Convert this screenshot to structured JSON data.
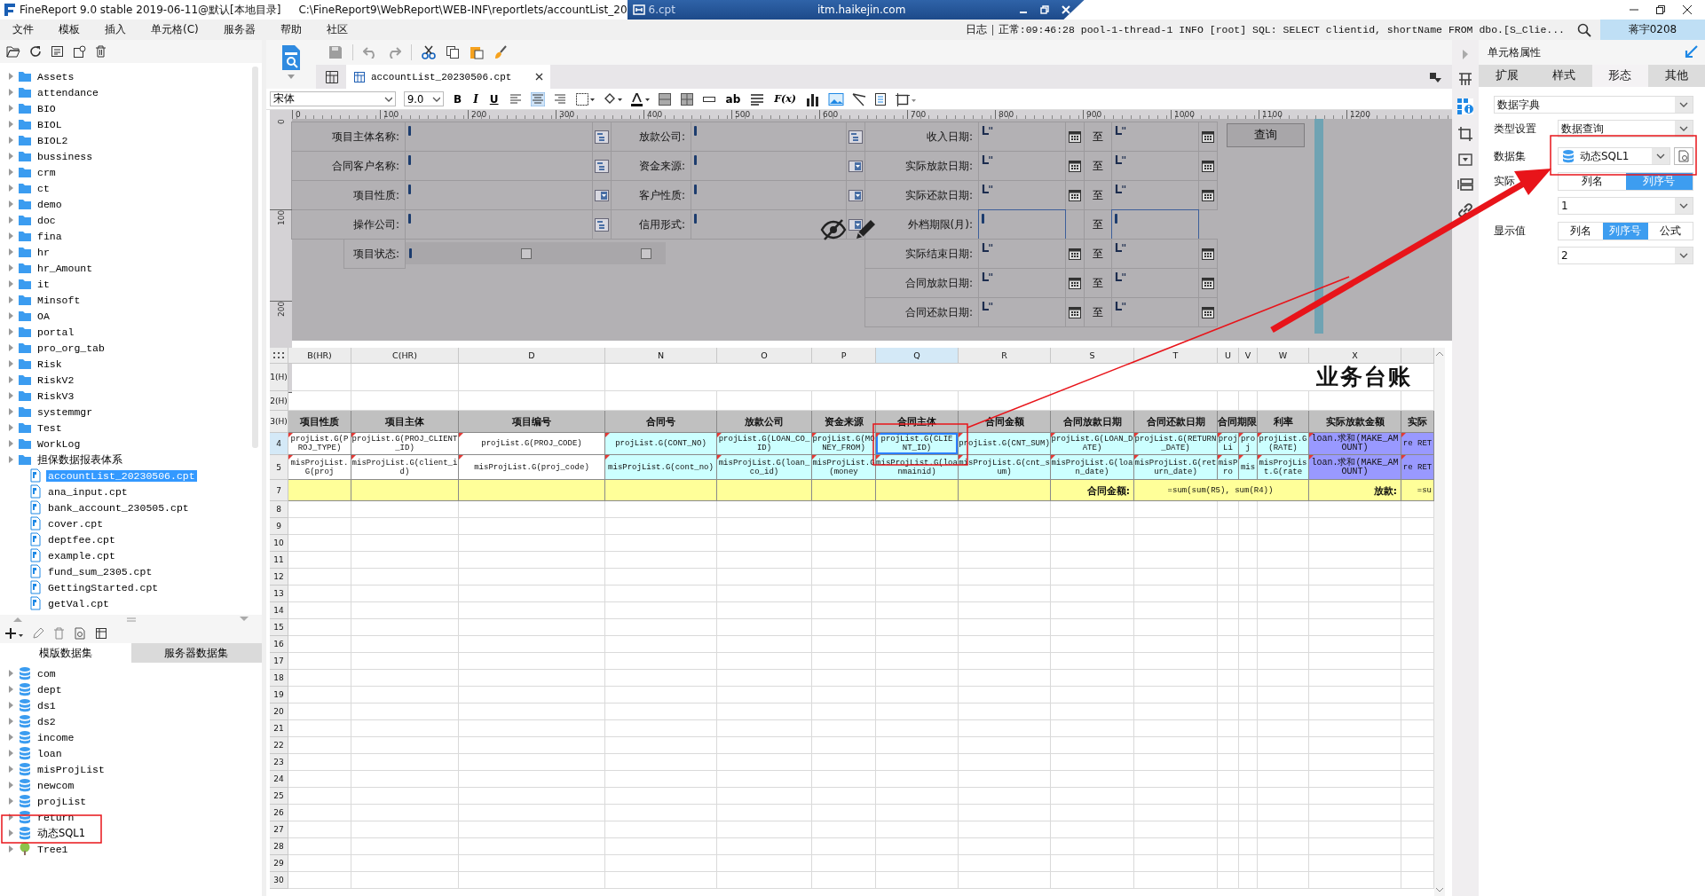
{
  "title_bar": {
    "app_title": "FineReport 9.0 stable 2019-06-11@默认[本地目录]",
    "file_path": "C:\\FineReport9\\WebReport\\WEB-INF\\reportlets/accountList_20",
    "overlay_window": {
      "tab_text": "6.cpt",
      "title": "itm.haikejin.com"
    }
  },
  "menu_bar": {
    "items": [
      "文件",
      "模板",
      "插入",
      "单元格(C)",
      "服务器",
      "帮助",
      "社区"
    ],
    "log_label": "日志",
    "log_message": "正常:09:46:28 pool-1-thread-1 INFO [root] SQL: SELECT clientid, shortName FROM dbo.[S_Clie...",
    "user": "蒋宇0208"
  },
  "template_tree": {
    "items": [
      {
        "name": "Assets",
        "kind": "folder",
        "selected": false
      },
      {
        "name": "attendance",
        "kind": "folder",
        "selected": false
      },
      {
        "name": "BIO",
        "kind": "folder",
        "selected": false
      },
      {
        "name": "BIOL",
        "kind": "folder",
        "selected": false
      },
      {
        "name": "BIOL2",
        "kind": "folder",
        "selected": false
      },
      {
        "name": "bussiness",
        "kind": "folder",
        "selected": false
      },
      {
        "name": "crm",
        "kind": "folder",
        "selected": false
      },
      {
        "name": "ct",
        "kind": "folder",
        "selected": false
      },
      {
        "name": "demo",
        "kind": "folder",
        "selected": false
      },
      {
        "name": "doc",
        "kind": "folder",
        "selected": false
      },
      {
        "name": "fina",
        "kind": "folder",
        "selected": false
      },
      {
        "name": "hr",
        "kind": "folder",
        "selected": false
      },
      {
        "name": "hr_Amount",
        "kind": "folder",
        "selected": false
      },
      {
        "name": "it",
        "kind": "folder",
        "selected": false
      },
      {
        "name": "Minsoft",
        "kind": "folder",
        "selected": false
      },
      {
        "name": "OA",
        "kind": "folder",
        "selected": false
      },
      {
        "name": "portal",
        "kind": "folder",
        "selected": false
      },
      {
        "name": "pro_org_tab",
        "kind": "folder",
        "selected": false
      },
      {
        "name": "Risk",
        "kind": "folder",
        "selected": false
      },
      {
        "name": "RiskV2",
        "kind": "folder",
        "selected": false
      },
      {
        "name": "RiskV3",
        "kind": "folder",
        "selected": false
      },
      {
        "name": "systemmgr",
        "kind": "folder",
        "selected": false
      },
      {
        "name": "Test",
        "kind": "folder",
        "selected": false
      },
      {
        "name": "WorkLog",
        "kind": "folder",
        "selected": false
      },
      {
        "name": "担保数据报表体系",
        "kind": "folder",
        "selected": false
      },
      {
        "name": "accountList_20230506.cpt",
        "kind": "file",
        "selected": true
      },
      {
        "name": "ana_input.cpt",
        "kind": "file",
        "selected": false
      },
      {
        "name": "bank_account_230505.cpt",
        "kind": "file",
        "selected": false
      },
      {
        "name": "cover.cpt",
        "kind": "file",
        "selected": false
      },
      {
        "name": "deptfee.cpt",
        "kind": "file",
        "selected": false
      },
      {
        "name": "example.cpt",
        "kind": "file",
        "selected": false
      },
      {
        "name": "fund_sum_2305.cpt",
        "kind": "file",
        "selected": false
      },
      {
        "name": "GettingStarted.cpt",
        "kind": "file",
        "selected": false
      },
      {
        "name": "getVal.cpt",
        "kind": "file",
        "selected": false
      }
    ]
  },
  "dataset_panel": {
    "tabs": [
      {
        "label": "模版数据集",
        "selected": true
      },
      {
        "label": "服务器数据集",
        "selected": false
      }
    ],
    "datasets": [
      {
        "name": "com",
        "kind": "db"
      },
      {
        "name": "dept",
        "kind": "db"
      },
      {
        "name": "ds1",
        "kind": "db"
      },
      {
        "name": "ds2",
        "kind": "db"
      },
      {
        "name": "income",
        "kind": "db"
      },
      {
        "name": "loan",
        "kind": "db"
      },
      {
        "name": "misProjList",
        "kind": "db"
      },
      {
        "name": "newcom",
        "kind": "db"
      },
      {
        "name": "projList",
        "kind": "db"
      },
      {
        "name": "return",
        "kind": "db"
      },
      {
        "name": "动态SQL1",
        "kind": "db"
      },
      {
        "name": "Tree1",
        "kind": "tree"
      }
    ]
  },
  "editor_tab": {
    "title": "accountList_20230506.cpt"
  },
  "format_toolbar": {
    "font": "宋体",
    "size": "9.0",
    "style_buttons": [
      "B",
      "I",
      "U"
    ],
    "text_buttons": [
      "ab",
      "F(x)"
    ]
  },
  "ruler": {
    "x_ticks": [
      "0",
      "100",
      "200",
      "300",
      "400",
      "500",
      "600",
      "700",
      "800",
      "900",
      "1000",
      "1100",
      "1200"
    ],
    "y_ticks": [
      "0",
      "100",
      "200"
    ]
  },
  "query_form": {
    "rows": [
      {
        "left": {
          "label": "项目主体名称:",
          "kind": "tree"
        },
        "middle": {
          "label": "放款公司:",
          "kind": "tree"
        },
        "right": {
          "label": "收入日期:",
          "kind": "date",
          "to": "至"
        }
      },
      {
        "left": {
          "label": "合同客户名称:",
          "kind": "tree"
        },
        "middle": {
          "label": "资金来源:",
          "kind": "dropdown"
        },
        "right": {
          "label": "实际放款日期:",
          "kind": "date",
          "to": "至"
        }
      },
      {
        "left": {
          "label": "项目性质:",
          "kind": "dropdown"
        },
        "middle": {
          "label": "客户性质:",
          "kind": "dropdown"
        },
        "right": {
          "label": "实际还款日期:",
          "kind": "date",
          "to": "至"
        }
      },
      {
        "left": {
          "label": "操作公司:",
          "kind": "tree"
        },
        "middle": {
          "label": "信用形式:",
          "kind": "dropdown"
        },
        "right": {
          "label": "外档期限(月):",
          "kind": "number",
          "to": "至"
        }
      },
      {
        "left": {
          "label": "项目状态:",
          "kind": "checkbox",
          "options": [
            {
              "checked": false
            },
            {
              "checked": false
            }
          ]
        },
        "right": {
          "label": "实际结束日期:",
          "kind": "date",
          "to": "至"
        }
      },
      {
        "right": {
          "label": "合同放款日期:",
          "kind": "date",
          "to": "至"
        }
      },
      {
        "right": {
          "label": "合同还款日期:",
          "kind": "date",
          "to": "至"
        }
      }
    ],
    "button": "查询"
  },
  "sheet": {
    "columns": [
      {
        "label": "B(HR)",
        "selected": false
      },
      {
        "label": "C(HR)",
        "selected": false
      },
      {
        "label": "D",
        "selected": false
      },
      {
        "label": "N",
        "selected": false
      },
      {
        "label": "O",
        "selected": false
      },
      {
        "label": "P",
        "selected": false
      },
      {
        "label": "Q",
        "selected": true
      },
      {
        "label": "R",
        "selected": false
      },
      {
        "label": "S",
        "selected": false
      },
      {
        "label": "T",
        "selected": false
      },
      {
        "label": "U",
        "selected": false
      },
      {
        "label": "V",
        "selected": false
      },
      {
        "label": "W",
        "selected": false
      },
      {
        "label": "X",
        "selected": false
      }
    ],
    "rows": [
      {
        "header": "1(H)",
        "kind": "title",
        "selected": false,
        "title": "业务台账"
      },
      {
        "header": "2(H)",
        "kind": "blank",
        "selected": false
      },
      {
        "header": "3(H)",
        "kind": "header",
        "selected": false,
        "color": "#c0c0c0",
        "cells": [
          "项目性质",
          "项目主体",
          "项目编号",
          "合同号",
          "放款公司",
          "资金来源",
          "合同主体",
          "合同金额",
          "合同放款日期",
          "合同还款日期",
          "合同期限",
          null,
          "利率",
          "实际放款金额",
          "实际"
        ]
      },
      {
        "header": "4",
        "kind": "data",
        "selected": true,
        "cells": [
          {
            "text": "projList.G(PROJ_TYPE)",
            "color": "#ffffff"
          },
          {
            "text": "projList.G(PROJ_CLIENT_ID)",
            "color": "#ffffff"
          },
          {
            "text": "projList.G(PROJ_CODE)",
            "color": "#ffffff"
          },
          {
            "text": "projList.G(CONT_NO)",
            "color": "#ccffff"
          },
          {
            "text": "projList.G(LOAN_CO_ID)",
            "color": "#ccffff"
          },
          {
            "text": "projList.G(MONEY_FROM)",
            "color": "#ccffff"
          },
          {
            "text": "projList.G(CLIENT_ID)",
            "color": "#ccffff"
          },
          {
            "text": "projList.G(CNT_SUM)",
            "color": "#ccffff"
          },
          {
            "text": "projList.G(LOAN_DATE)",
            "color": "#ccffff"
          },
          {
            "text": "projList.G(RETURN_DATE)",
            "color": "#ccffff"
          },
          {
            "text": "projLi",
            "color": "#ccffff"
          },
          {
            "text": "proj",
            "color": "#ccffff"
          },
          {
            "text": "projList.G(RATE)",
            "color": "#ccffff"
          },
          {
            "text": "loan.求和(MAKE_AMOUNT)",
            "color": "#9999ff"
          },
          {
            "text": "re RET",
            "color": "#9999ff"
          }
        ]
      },
      {
        "header": "5",
        "kind": "data",
        "selected": false,
        "cells": [
          {
            "text": "misProjList.G(proj",
            "color": "#ffffff"
          },
          {
            "text": "misProjList.G(client_id)",
            "color": "#ffffff"
          },
          {
            "text": "misProjList.G(proj_code)",
            "color": "#ffffff"
          },
          {
            "text": "misProjList.G(cont_no)",
            "color": "#ccffff"
          },
          {
            "text": "misProjList.G(loan_co_id)",
            "color": "#ccffff"
          },
          {
            "text": "misProjList.G(money",
            "color": "#ccffff"
          },
          {
            "text": "misProjList.G(loanmainid)",
            "color": "#ccffff"
          },
          {
            "text": "misProjList.G(cnt_sum)",
            "color": "#ccffff"
          },
          {
            "text": "misProjList.G(loan_date)",
            "color": "#ccffff"
          },
          {
            "text": "misProjList.G(return_date)",
            "color": "#ccffff"
          },
          {
            "text": "misPro",
            "color": "#ccffff"
          },
          {
            "text": "mis",
            "color": "#ccffff"
          },
          {
            "text": "misProjList.G(rate",
            "color": "#ccffff"
          },
          {
            "text": "loan.求和(MAKE_AMOUNT)",
            "color": "#9999ff"
          },
          {
            "text": "re RET",
            "color": "#9999ff"
          }
        ]
      },
      {
        "header": "7",
        "kind": "summary",
        "selected": false,
        "color": "#ffff99",
        "cells": [
          null,
          null,
          null,
          null,
          null,
          null,
          null,
          null,
          "合同金额:",
          "=sum(sum(R5), sum(R4))",
          null,
          null,
          null,
          "放款:",
          "=su"
        ]
      },
      {
        "header": "8",
        "kind": "blank",
        "selected": false
      },
      {
        "header": "9",
        "kind": "blank",
        "selected": false
      },
      {
        "header": "10",
        "kind": "blank",
        "selected": false
      },
      {
        "header": "11",
        "kind": "blank",
        "selected": false
      },
      {
        "header": "12",
        "kind": "blank",
        "selected": false
      },
      {
        "header": "13",
        "kind": "blank",
        "selected": false
      },
      {
        "header": "14",
        "kind": "blank",
        "selected": false
      },
      {
        "header": "15",
        "kind": "blank",
        "selected": false
      },
      {
        "header": "16",
        "kind": "blank",
        "selected": false
      },
      {
        "header": "17",
        "kind": "blank",
        "selected": false
      },
      {
        "header": "18",
        "kind": "blank",
        "selected": false
      },
      {
        "header": "19",
        "kind": "blank",
        "selected": false
      },
      {
        "header": "20",
        "kind": "blank",
        "selected": false
      },
      {
        "header": "21",
        "kind": "blank",
        "selected": false
      },
      {
        "header": "22",
        "kind": "blank",
        "selected": false
      },
      {
        "header": "23",
        "kind": "blank",
        "selected": false
      },
      {
        "header": "24",
        "kind": "blank",
        "selected": false
      },
      {
        "header": "25",
        "kind": "blank",
        "selected": false
      },
      {
        "header": "26",
        "kind": "blank",
        "selected": false
      },
      {
        "header": "27",
        "kind": "blank",
        "selected": false
      },
      {
        "header": "28",
        "kind": "blank",
        "selected": false
      },
      {
        "header": "29",
        "kind": "blank",
        "selected": false
      },
      {
        "header": "30",
        "kind": "blank",
        "selected": false
      }
    ]
  },
  "property_panel": {
    "title": "单元格属性",
    "tabs": [
      {
        "label": "扩展",
        "selected": false
      },
      {
        "label": "样式",
        "selected": false
      },
      {
        "label": "形态",
        "selected": true
      },
      {
        "label": "其他",
        "selected": false
      }
    ],
    "widget_type": "数据字典",
    "type_setting": {
      "label": "类型设置",
      "value": "数据查询"
    },
    "dataset": {
      "label": "数据集",
      "value": "动态SQL1"
    },
    "actual_value": {
      "label": "实际",
      "modes": [
        {
          "label": "列名",
          "selected": false
        },
        {
          "label": "列序号",
          "selected": true
        }
      ],
      "value": "1"
    },
    "display_value": {
      "label": "显示值",
      "modes": [
        {
          "label": "列名",
          "selected": false
        },
        {
          "label": "列序号",
          "selected": true
        },
        {
          "label": "公式",
          "selected": false
        }
      ],
      "value": "2"
    }
  }
}
